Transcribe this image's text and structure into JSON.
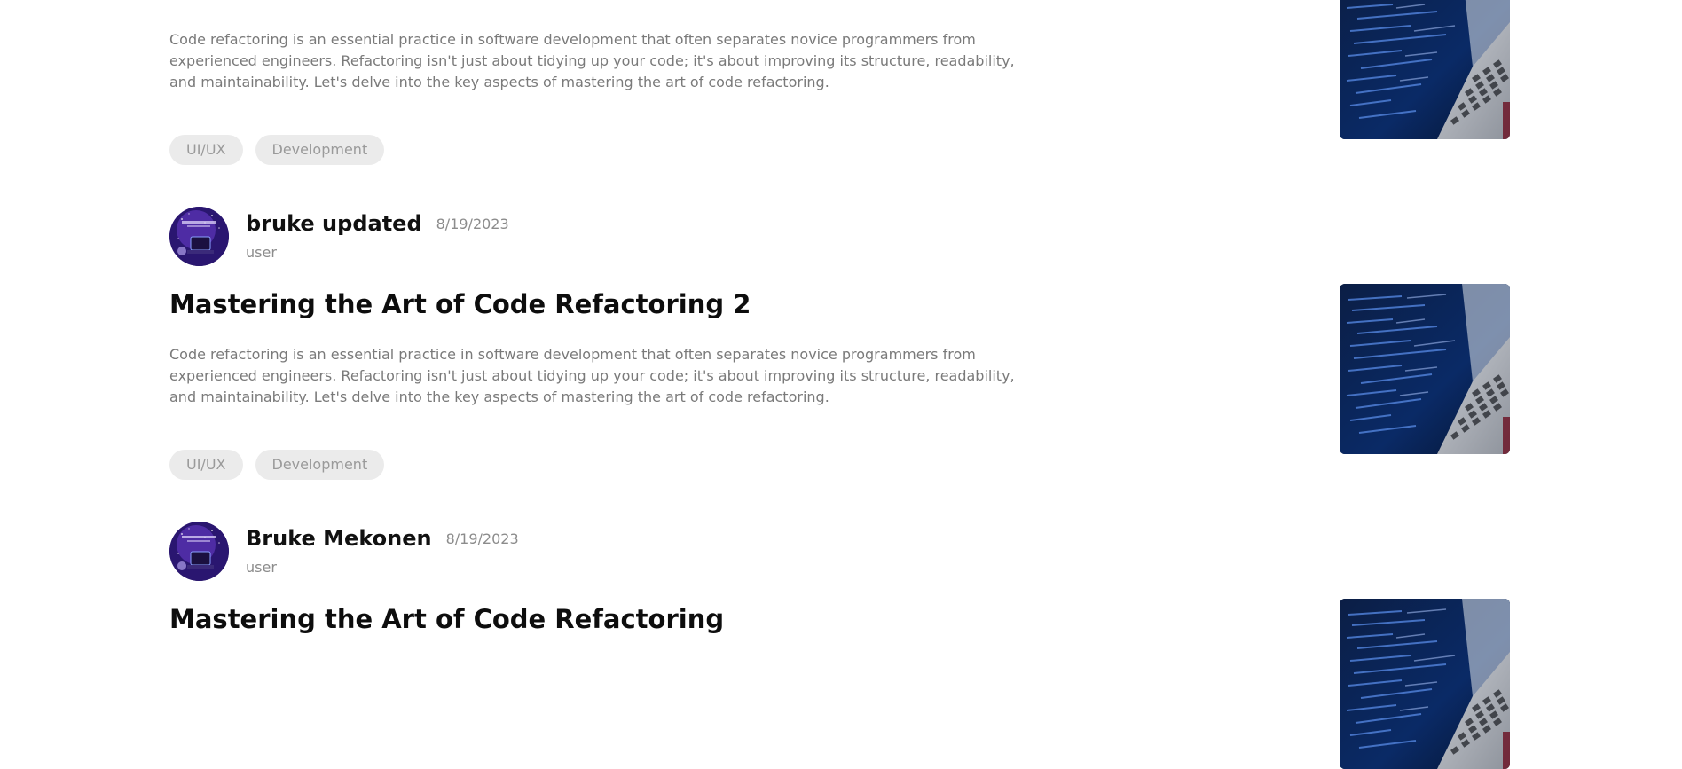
{
  "posts": [
    {
      "author": {
        "name": "",
        "date": "",
        "role": ""
      },
      "title": "",
      "excerpt": "Code refactoring is an essential practice in software development that often separates novice programmers from experienced engineers. Refactoring isn't just about tidying up your code; it's about improving its structure, readability, and maintainability. Let's delve into the key aspects of mastering the art of code refactoring.",
      "tags": [
        "UI/UX",
        "Development"
      ],
      "thumbnail_icon": "laptop-code-image"
    },
    {
      "author": {
        "name": "bruke updated",
        "date": "8/19/2023",
        "role": "user"
      },
      "title": "Mastering the Art of Code Refactoring 2",
      "excerpt": "Code refactoring is an essential practice in software development that often separates novice programmers from experienced engineers. Refactoring isn't just about tidying up your code; it's about improving its structure, readability, and maintainability. Let's delve into the key aspects of mastering the art of code refactoring.",
      "tags": [
        "UI/UX",
        "Development"
      ],
      "thumbnail_icon": "laptop-code-image"
    },
    {
      "author": {
        "name": "Bruke Mekonen",
        "date": "8/19/2023",
        "role": "user"
      },
      "title": "Mastering the Art of Code Refactoring",
      "excerpt": "",
      "tags": [],
      "thumbnail_icon": "laptop-code-image"
    }
  ],
  "colors": {
    "title": "#0d0d0d",
    "meta": "#8c8c8c",
    "excerpt": "#7a7a7a",
    "tag_bg": "#ebebeb",
    "tag_text": "#9a9a9a"
  }
}
